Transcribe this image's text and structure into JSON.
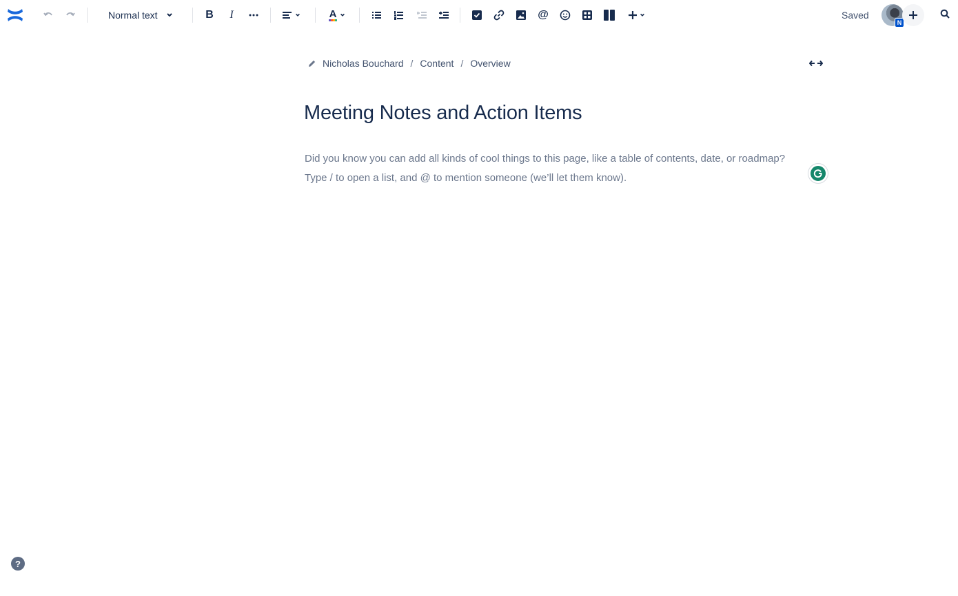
{
  "toolbar": {
    "logo": "confluence-logo",
    "undo": "undo-icon",
    "redo": "redo-icon",
    "text_style": "Normal text",
    "bold": "B",
    "italic": "I",
    "more_formatting": "more-formatting-icon",
    "alignment": "align-left-icon",
    "text_color": "A",
    "bullet_list": "bullet-list-icon",
    "numbered_list": "numbered-list-icon",
    "outdent": "outdent-icon",
    "indent": "indent-icon",
    "action_item": "checkbox-icon",
    "link": "link-icon",
    "image": "image-icon",
    "mention": "@",
    "emoji": "emoji-icon",
    "table": "table-icon",
    "layouts": "layout-icon",
    "insert": "plus-icon",
    "status": "Saved",
    "avatar_badge": "N"
  },
  "breadcrumb": {
    "items": [
      "Nicholas Bouchard",
      "Content",
      "Overview"
    ],
    "separator": "/"
  },
  "page": {
    "title": "Meeting Notes and Action Items",
    "placeholder_line1": "Did you know you can add all kinds of cool things to this page, like a table of contents, date, or roadmap?",
    "placeholder_line2": "Type / to open a list, and @ to mention someone (we’ll let them know)."
  },
  "help": {
    "label": "?"
  },
  "colors": {
    "brand": "#1868db",
    "text": "#172b4d",
    "subtle": "#42526e",
    "placeholder": "#6b778c",
    "grammarly": "#15876b"
  }
}
